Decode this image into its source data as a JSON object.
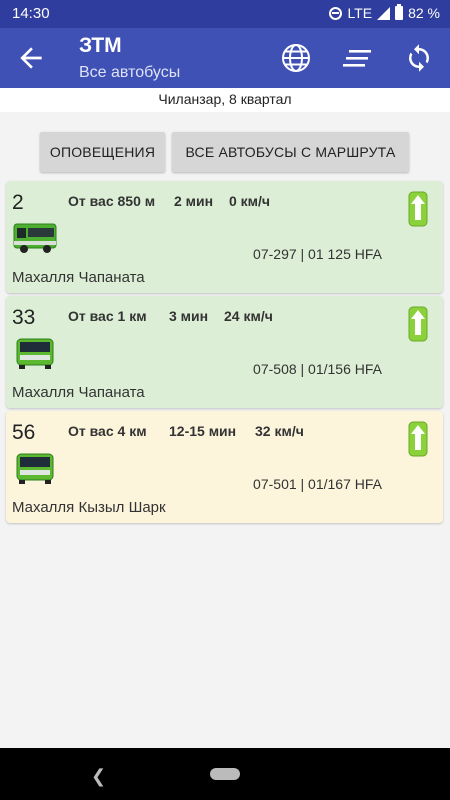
{
  "status_bar": {
    "time": "14:30",
    "network": "LTE",
    "battery": "82 %"
  },
  "app_bar": {
    "title": "ЗТМ",
    "subtitle": "Все автобусы",
    "icons": [
      "back-arrow-icon",
      "globe-icon",
      "sort-lines-icon",
      "refresh-icon"
    ]
  },
  "location": "Чиланзар, 8 квартал",
  "buttons": {
    "alerts": "ОПОВЕЩЕНИЯ",
    "all_route_buses": "ВСЕ АВТОБУСЫ С МАРШРУТА"
  },
  "buses": [
    {
      "route": "2",
      "distance": "От вас 850 м",
      "eta": "2 мин",
      "speed": "0 км/ч",
      "plate": "07-297 | 01 125 HFA",
      "stop": "Махалля Чапаната",
      "status_color": "#dcefd6"
    },
    {
      "route": "33",
      "distance": "От вас 1 км",
      "eta": "3 мин",
      "speed": "24 км/ч",
      "plate": "07-508 | 01/156 HFA",
      "stop": "Махалля Чапаната",
      "status_color": "#dcefd6"
    },
    {
      "route": "56",
      "distance": "От вас 4 км",
      "eta": "12-15 мин",
      "speed": "32 км/ч",
      "plate": "07-501 | 01/167 HFA",
      "stop": "Махалля Кызыл Шарк",
      "status_color": "#fcf5dc"
    }
  ],
  "colors": {
    "primary": "#3f51b5",
    "status_bar": "#2f3d9e",
    "bus_green": "#5cb82e",
    "arrow_green": "#7ccf2e"
  }
}
